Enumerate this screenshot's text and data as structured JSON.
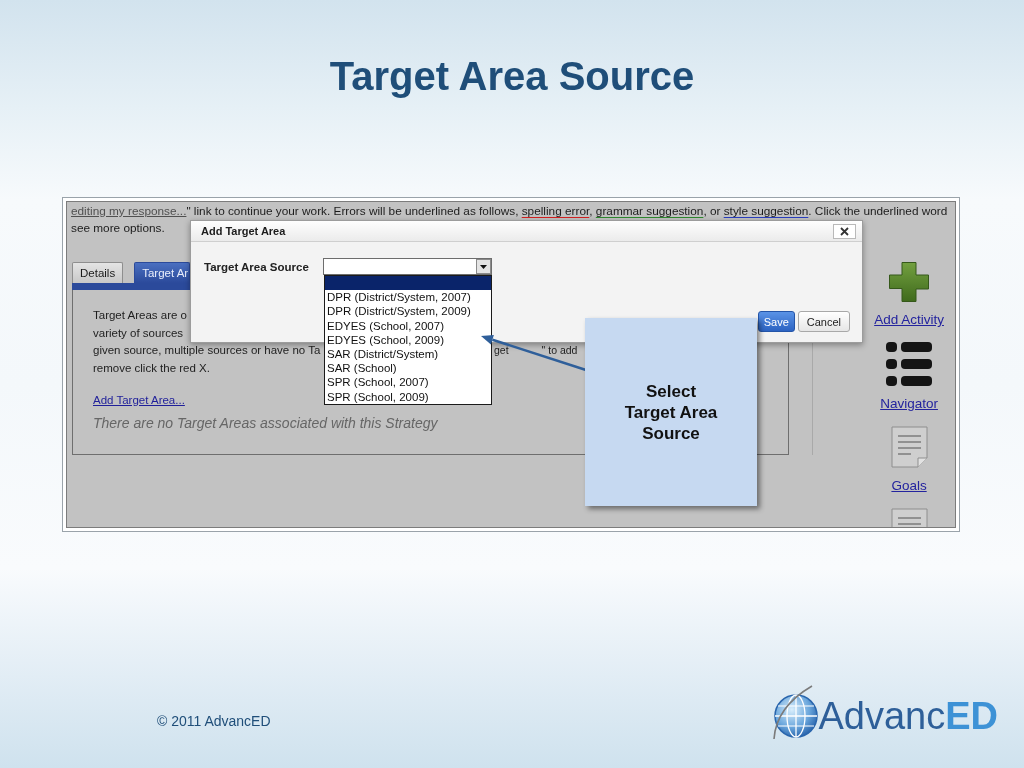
{
  "slide": {
    "title": "Target Area Source",
    "footer": "© 2011 AdvancED",
    "logo": "Advanc**ED**"
  },
  "app": {
    "notice": [
      {
        "kind": "link",
        "text": "editing my response..."
      },
      {
        "kind": "plain",
        "text": "\" link to continue your work. Errors will be underlined as follows, "
      },
      {
        "kind": "spelling",
        "text": "spelling error"
      },
      {
        "kind": "plain",
        "text": ", "
      },
      {
        "kind": "grammar",
        "text": "grammar suggestion"
      },
      {
        "kind": "plain",
        "text": ", or "
      },
      {
        "kind": "style",
        "text": "style suggestion"
      },
      {
        "kind": "plain",
        "text": ". Click the underlined word see more options."
      }
    ],
    "tabs": [
      {
        "label": "Details",
        "selected": false
      },
      {
        "label": "Target Ar",
        "selected": true
      }
    ],
    "panel": {
      "lines": [
        {
          "text": "Target Areas are o"
        },
        {
          "text": "variety of sources"
        },
        {
          "text": "given source, multiple sources or have no Ta",
          "continued": [
            "get",
            "\" to add"
          ]
        },
        {
          "text": "remove click the red X."
        }
      ],
      "add_link": "Add Target Area...",
      "empty_message": "There are no Target Areas associated with this Strategy"
    },
    "sidebar": [
      {
        "kind": "add",
        "label": "Add Activity"
      },
      {
        "kind": "list",
        "label": "Navigator"
      },
      {
        "kind": "document",
        "label": "Goals"
      },
      {
        "kind": "document"
      }
    ]
  },
  "dialog": {
    "title": "Add Target Area",
    "field_label": "Target Area Source",
    "options": [
      {
        "selected": true
      },
      {
        "label": "DPR (District/System, 2007)",
        "selected": false
      },
      {
        "label": "DPR (District/System, 2009)",
        "selected": false
      },
      {
        "label": "EDYES (School, 2007)",
        "selected": false
      },
      {
        "label": "EDYES (School, 2009)",
        "selected": false
      },
      {
        "label": "SAR (District/System)",
        "selected": false
      },
      {
        "label": "SAR (School)",
        "selected": false
      },
      {
        "label": "SPR (School, 2007)",
        "selected": false
      },
      {
        "label": "SPR (School, 2009)",
        "selected": false
      }
    ],
    "buttons": [
      {
        "kind": "primary",
        "label": "Save"
      },
      {
        "kind": "secondary",
        "label": "Cancel"
      }
    ]
  },
  "callout": {
    "text": "Select Target Area Source"
  }
}
